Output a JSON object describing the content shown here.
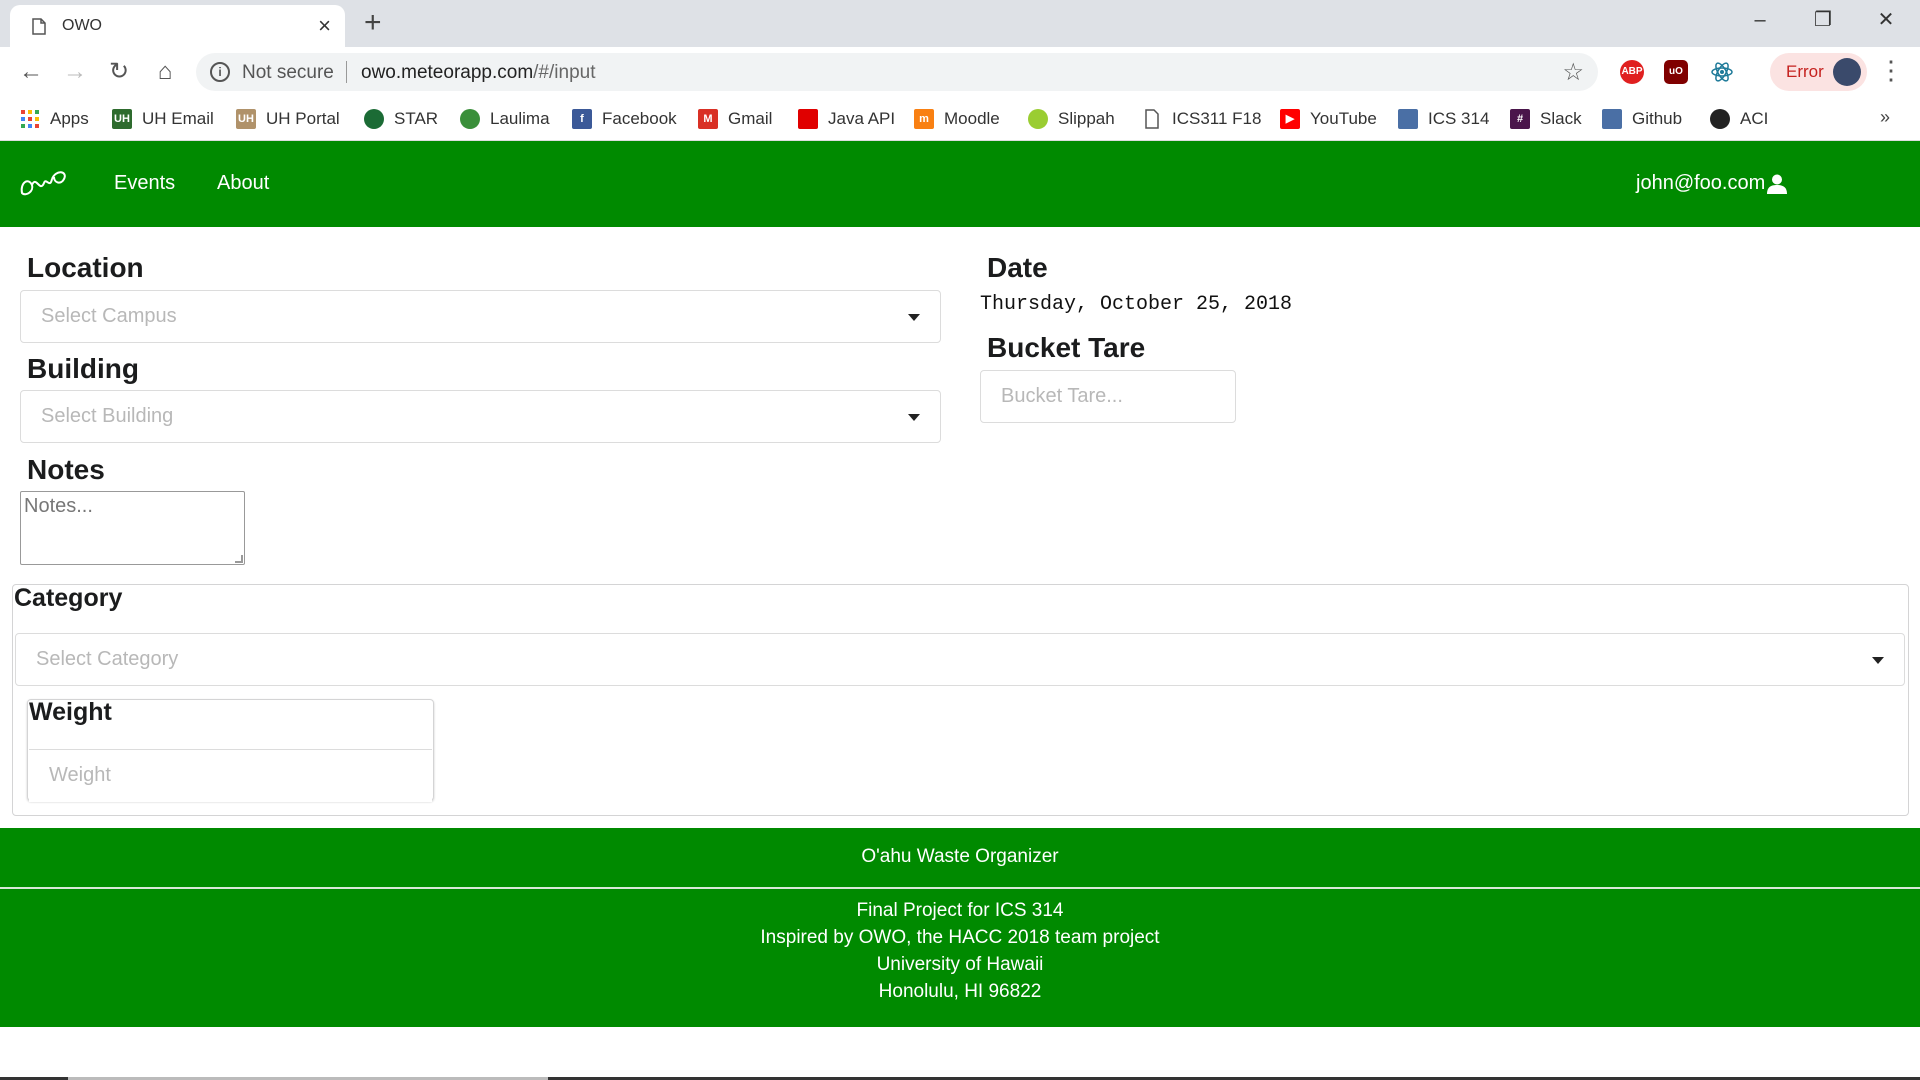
{
  "browser": {
    "tab_title": "OWO",
    "tab_close": "×",
    "new_tab": "+",
    "window": {
      "minimize": "–",
      "restore": "❐",
      "close": "✕"
    },
    "address": {
      "security_label": "Not secure",
      "url_host": "owo.meteorapp.com",
      "url_path": "/#/input"
    },
    "extensions": [
      {
        "name": "ABP",
        "color": "#e02020"
      },
      {
        "name": "uO",
        "color": "#800000"
      },
      {
        "name": "react",
        "color": "#20232a"
      }
    ],
    "error_label": "Error",
    "bookmarks": [
      {
        "label": "Apps",
        "icon": "apps-grid-icon",
        "color": "#e94235"
      },
      {
        "label": "UH Email",
        "icon": "uh-icon",
        "color": "#2e6b2e",
        "glyph": "UH"
      },
      {
        "label": "UH Portal",
        "icon": "uh-icon",
        "color": "#b0926a",
        "glyph": "UH"
      },
      {
        "label": "STAR",
        "icon": "star-logo-icon",
        "color": "#1b6b35"
      },
      {
        "label": "Laulima",
        "icon": "leaf-icon",
        "color": "#3a8f3a"
      },
      {
        "label": "Facebook",
        "icon": "facebook-icon",
        "color": "#3b5998",
        "glyph": "f"
      },
      {
        "label": "Gmail",
        "icon": "gmail-icon",
        "color": "#d93025",
        "glyph": "M"
      },
      {
        "label": "Java API",
        "icon": "oracle-icon",
        "color": "#e00000"
      },
      {
        "label": "Moodle",
        "icon": "moodle-icon",
        "color": "#f98012",
        "glyph": "m"
      },
      {
        "label": "Slippah",
        "icon": "slippah-icon",
        "color": "#9acd32"
      },
      {
        "label": "ICS311 F18",
        "icon": "page-icon",
        "color": "#777777"
      },
      {
        "label": "YouTube",
        "icon": "youtube-icon",
        "color": "#ff0000",
        "glyph": "▶"
      },
      {
        "label": "ICS 314",
        "icon": "square-icon",
        "color": "#4a6fa5"
      },
      {
        "label": "Slack",
        "icon": "slack-icon",
        "color": "#4a154b",
        "glyph": "#"
      },
      {
        "label": "Github",
        "icon": "square-icon",
        "color": "#4a6fa5"
      },
      {
        "label": "ACI",
        "icon": "github-icon",
        "color": "#222222"
      }
    ],
    "bookmarks_more": "»"
  },
  "navbar": {
    "brand_color": "#008a00",
    "links": [
      "Events",
      "About"
    ],
    "user_email": "john@foo.com"
  },
  "form": {
    "location": {
      "label": "Location",
      "placeholder": "Select Campus"
    },
    "building": {
      "label": "Building",
      "placeholder": "Select Building"
    },
    "notes": {
      "label": "Notes",
      "placeholder": "Notes..."
    },
    "date": {
      "label": "Date",
      "value": "Thursday, October 25, 2018"
    },
    "bucket_tare": {
      "label": "Bucket Tare",
      "placeholder": "Bucket Tare..."
    },
    "category": {
      "label": "Category",
      "placeholder": "Select Category"
    },
    "weight": {
      "label": "Weight",
      "placeholder": "Weight"
    }
  },
  "footer": {
    "title": "O'ahu Waste Organizer",
    "lines": [
      "Final Project for ICS 314",
      "Inspired by OWO, the HACC 2018 team project",
      "University of Hawaii",
      "Honolulu, HI 96822"
    ]
  }
}
